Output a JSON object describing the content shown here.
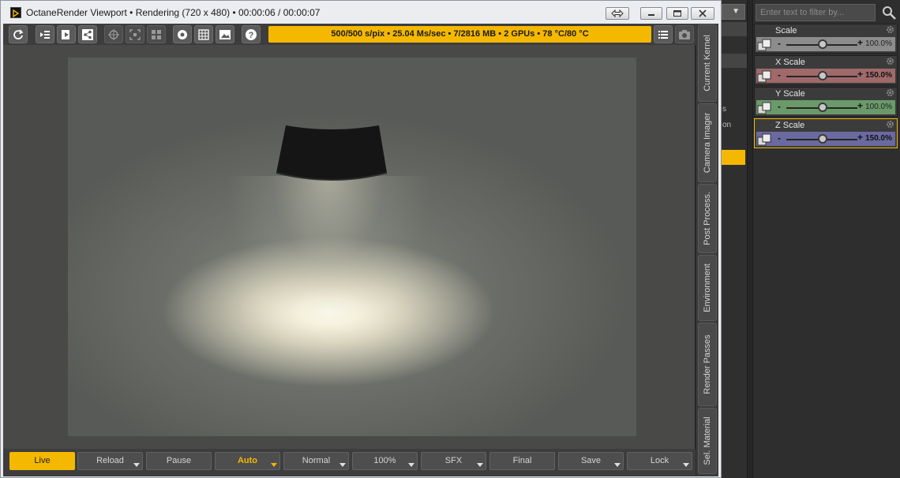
{
  "window": {
    "title": "OctaneRender Viewport • Rendering (720 x 480) • 00:00:06 / 00:00:07"
  },
  "toolbar": {
    "stats": "500/500 s/pix • 25.04 Ms/sec • 7/2816 MB • 2 GPUs • 78 °C/80 °C",
    "buttons": [
      "refresh-icon",
      "import-list-icon",
      "export-icon",
      "share-nodes-icon",
      "target-icon",
      "region-icon",
      "grid-quad-icon",
      "circle-icon",
      "grid-icon",
      "image-icon",
      "help-icon"
    ]
  },
  "side_tabs": [
    "Current Kernel",
    "Camera Imager",
    "Post Process.",
    "Environment",
    "Render Passes",
    "Sel. Material"
  ],
  "bottom_buttons": {
    "live": "Live",
    "reload": "Reload",
    "pause": "Pause",
    "auto": "Auto",
    "normal": "Normal",
    "zoom": "100%",
    "sfx": "SFX",
    "final": "Final",
    "save": "Save",
    "lock": "Lock"
  },
  "host_fragments": [
    "s",
    "on"
  ],
  "filter": {
    "placeholder": "Enter text to filter by..."
  },
  "sliders": [
    {
      "label": "Scale",
      "value": "100.0%",
      "color": "#8c8c8c",
      "bold": false
    },
    {
      "label": "X Scale",
      "value": "150.0%",
      "color": "#a06a6a",
      "bold": true
    },
    {
      "label": "Y Scale",
      "value": "100.0%",
      "color": "#6a9a6a",
      "bold": false
    },
    {
      "label": "Z Scale",
      "value": "150.0%",
      "color": "#6a6aa0",
      "bold": true
    }
  ],
  "colors": {
    "accent": "#f5b800"
  }
}
